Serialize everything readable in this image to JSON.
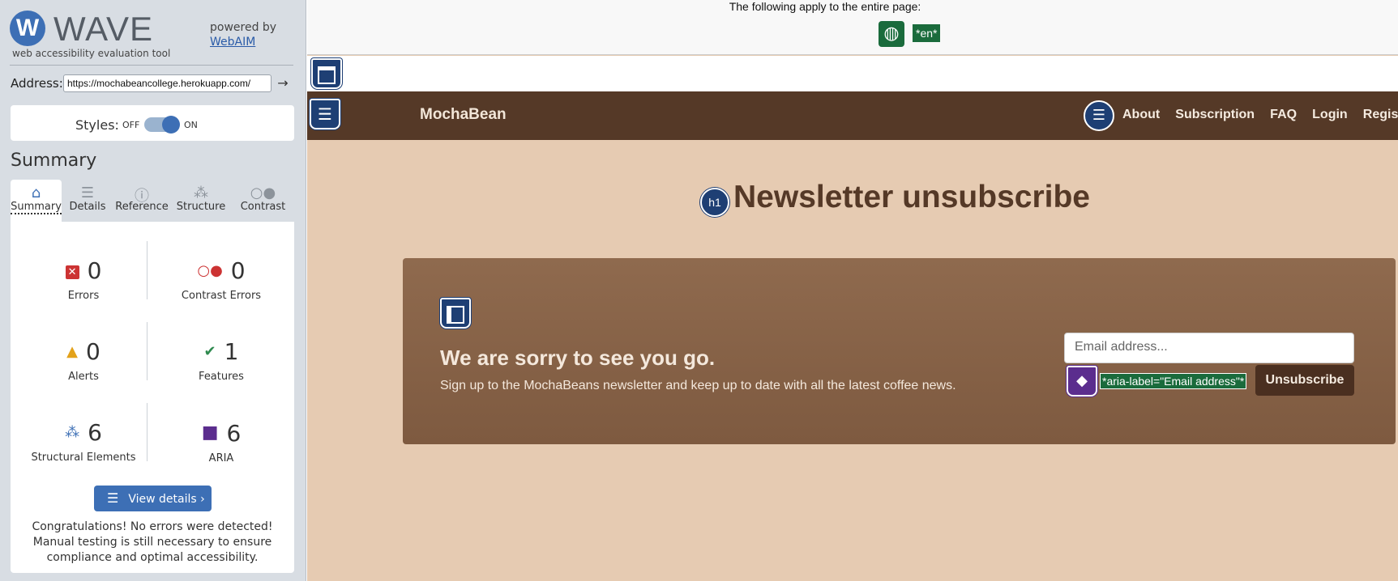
{
  "wave": {
    "logo_letter": "W",
    "wordmark": "WAVE",
    "tagline": "web accessibility evaluation tool",
    "powered_by": "powered by",
    "webaim_link": "WebAIM",
    "address_label": "Address:",
    "address_value": "https://mochabeancollege.herokuapp.com/",
    "go_icon": "arrow-right-icon",
    "styles_label": "Styles:",
    "styles_off": "OFF",
    "styles_on": "ON",
    "styles_enabled": true,
    "summary_title": "Summary",
    "tabs": [
      {
        "label": "Summary",
        "icon": "home-icon",
        "glyph": "⌂",
        "active": true
      },
      {
        "label": "Details",
        "icon": "list-icon",
        "glyph": "☰",
        "active": false
      },
      {
        "label": "Reference",
        "icon": "info-icon",
        "glyph": "ⓘ",
        "active": false
      },
      {
        "label": "Structure",
        "icon": "hierarchy-icon",
        "glyph": "⁂",
        "active": false
      },
      {
        "label": "Contrast",
        "icon": "contrast-icon",
        "glyph": "○●",
        "active": false
      }
    ],
    "stats": {
      "errors": {
        "count": "0",
        "label": "Errors",
        "color": "#cc3333"
      },
      "contrast_errors": {
        "count": "0",
        "label": "Contrast Errors",
        "color": "#cc3333"
      },
      "alerts": {
        "count": "0",
        "label": "Alerts",
        "color": "#e3a21a"
      },
      "features": {
        "count": "1",
        "label": "Features",
        "color": "#2f8a4f"
      },
      "structural": {
        "count": "6",
        "label": "Structural Elements",
        "color": "#3d6fb5"
      },
      "aria": {
        "count": "6",
        "label": "ARIA",
        "color": "#5b2d8e"
      }
    },
    "view_details": "View details ›",
    "congrats": "Congratulations! No errors were detected! Manual testing is still necessary to ensure compliance and optimal accessibility."
  },
  "page": {
    "applies_note": "The following apply to the entire page:",
    "lang_tag": "*en*",
    "brand": "MochaBean",
    "nav": [
      "About",
      "Subscription",
      "FAQ",
      "Login",
      "Register"
    ],
    "h1_badge": "h1",
    "heading": "Newsletter unsubscribe",
    "card_heading": "We are sorry to see you go.",
    "card_text": "Sign up to the MochaBeans newsletter and keep up to date with all the latest coffee news.",
    "email_placeholder": "Email address...",
    "aria_label_tag": "*aria-label=\"Email address\"*",
    "unsubscribe": "Unsubscribe"
  },
  "colors": {
    "wave_blue": "#3d6fb5",
    "nav_brown": "#553927",
    "page_bg": "#e6cbb2",
    "feature_green": "#1a6b3c",
    "aria_purple": "#5b2d8e"
  }
}
